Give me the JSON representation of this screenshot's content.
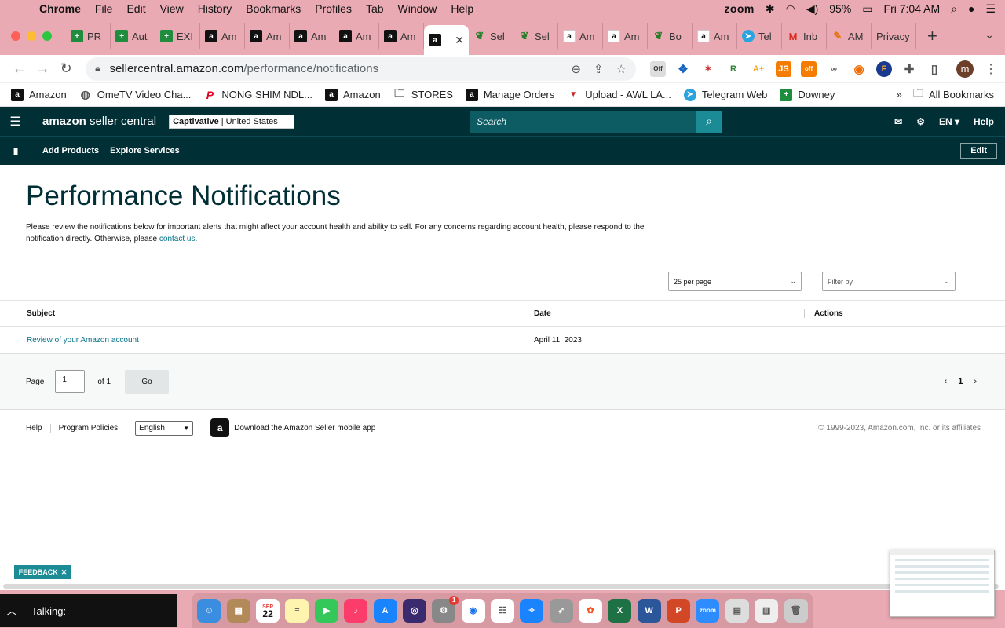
{
  "menubar": {
    "app": "Chrome",
    "items": [
      "File",
      "Edit",
      "View",
      "History",
      "Bookmarks",
      "Profiles",
      "Tab",
      "Window",
      "Help"
    ],
    "zoom": "zoom",
    "battery": "95%",
    "clock": "Fri 7:04 AM"
  },
  "tabs": [
    {
      "label": "PR",
      "icon": "sheets-icon"
    },
    {
      "label": "Aut",
      "icon": "sheets-icon"
    },
    {
      "label": "EXI",
      "icon": "sheets-icon"
    },
    {
      "label": "Am",
      "icon": "amazon-icon"
    },
    {
      "label": "Am",
      "icon": "amazon-icon"
    },
    {
      "label": "Am",
      "icon": "amazon-icon"
    },
    {
      "label": "Am",
      "icon": "amazon-icon"
    },
    {
      "label": "Am",
      "icon": "amazon-icon"
    },
    {
      "label": "",
      "icon": "amazon-icon",
      "active": true
    },
    {
      "label": "Sel",
      "icon": "leaf-icon"
    },
    {
      "label": "Sel",
      "icon": "leaf-icon"
    },
    {
      "label": "Am",
      "icon": "amazon-white-icon"
    },
    {
      "label": "Am",
      "icon": "amazon-white-icon"
    },
    {
      "label": "Bo",
      "icon": "leaf-icon"
    },
    {
      "label": "Am",
      "icon": "amazon-white-icon"
    },
    {
      "label": "Tel",
      "icon": "telegram-icon"
    },
    {
      "label": "Inb",
      "icon": "gmail-icon"
    },
    {
      "label": "AM",
      "icon": "marker-icon"
    },
    {
      "label": "Privacy",
      "icon": ""
    }
  ],
  "address": {
    "domain": "sellercentral.amazon.com",
    "path": "/performance/notifications"
  },
  "extensions": {
    "off_badge": "Off",
    "off_badge2": "off",
    "avatar": "m"
  },
  "bookmarks": [
    {
      "label": "Amazon",
      "icon": "amazon-icon"
    },
    {
      "label": "OmeTV Video Cha...",
      "icon": "globe-icon"
    },
    {
      "label": "NONG SHIM NDL...",
      "icon": "calendar-icon"
    },
    {
      "label": "Amazon",
      "icon": "pinterest-icon"
    },
    {
      "label": "STORES",
      "icon": "amazon-icon"
    },
    {
      "label": "Manage Orders",
      "icon": "folder-icon"
    },
    {
      "label": "Upload - AWL LA...",
      "icon": "amazon-icon"
    },
    {
      "label": "Telegram Web",
      "icon": "awl-icon"
    },
    {
      "label": "Downey",
      "icon": "telegram-icon"
    }
  ],
  "bookmarks_extra": {
    "overflow": "»",
    "all": "All Bookmarks"
  },
  "seller": {
    "logo_bold": "amazon",
    "logo_rest": " seller central",
    "store": "Captivative",
    "region": "| United States",
    "search_placeholder": "Search",
    "lang": "EN",
    "help": "Help",
    "subnav": {
      "add_products": "Add Products",
      "explore_services": "Explore Services",
      "edit": "Edit"
    }
  },
  "page": {
    "title": "Performance Notifications",
    "desc": "Please review the notifications below for important alerts that might affect your account health and ability to sell. For any concerns regarding account health, please respond to the notification directly. Otherwise, please ",
    "desc_link": "contact us",
    "desc_end": ".",
    "per_page": "25 per page",
    "filter_placeholder": "Filter by"
  },
  "table": {
    "headers": {
      "subject": "Subject",
      "date": "Date",
      "actions": "Actions"
    },
    "rows": [
      {
        "subject": "Review of your Amazon account",
        "date": "April 11, 2023",
        "actions": ""
      }
    ]
  },
  "pager": {
    "label": "Page",
    "value": "1",
    "of": "of 1",
    "go": "Go",
    "current": "1"
  },
  "footer": {
    "help": "Help",
    "policies": "Program Policies",
    "language": "English",
    "app_text": "Download the Amazon Seller mobile app",
    "copyright": "© 1999-2023, Amazon.com, Inc. or its affiliates"
  },
  "feedback": "FEEDBACK",
  "talking": "Talking:",
  "dock": {
    "calendar_day": "22",
    "calendar_month": "SEP",
    "settings_badge": "1",
    "zoom_label": "zoom"
  }
}
